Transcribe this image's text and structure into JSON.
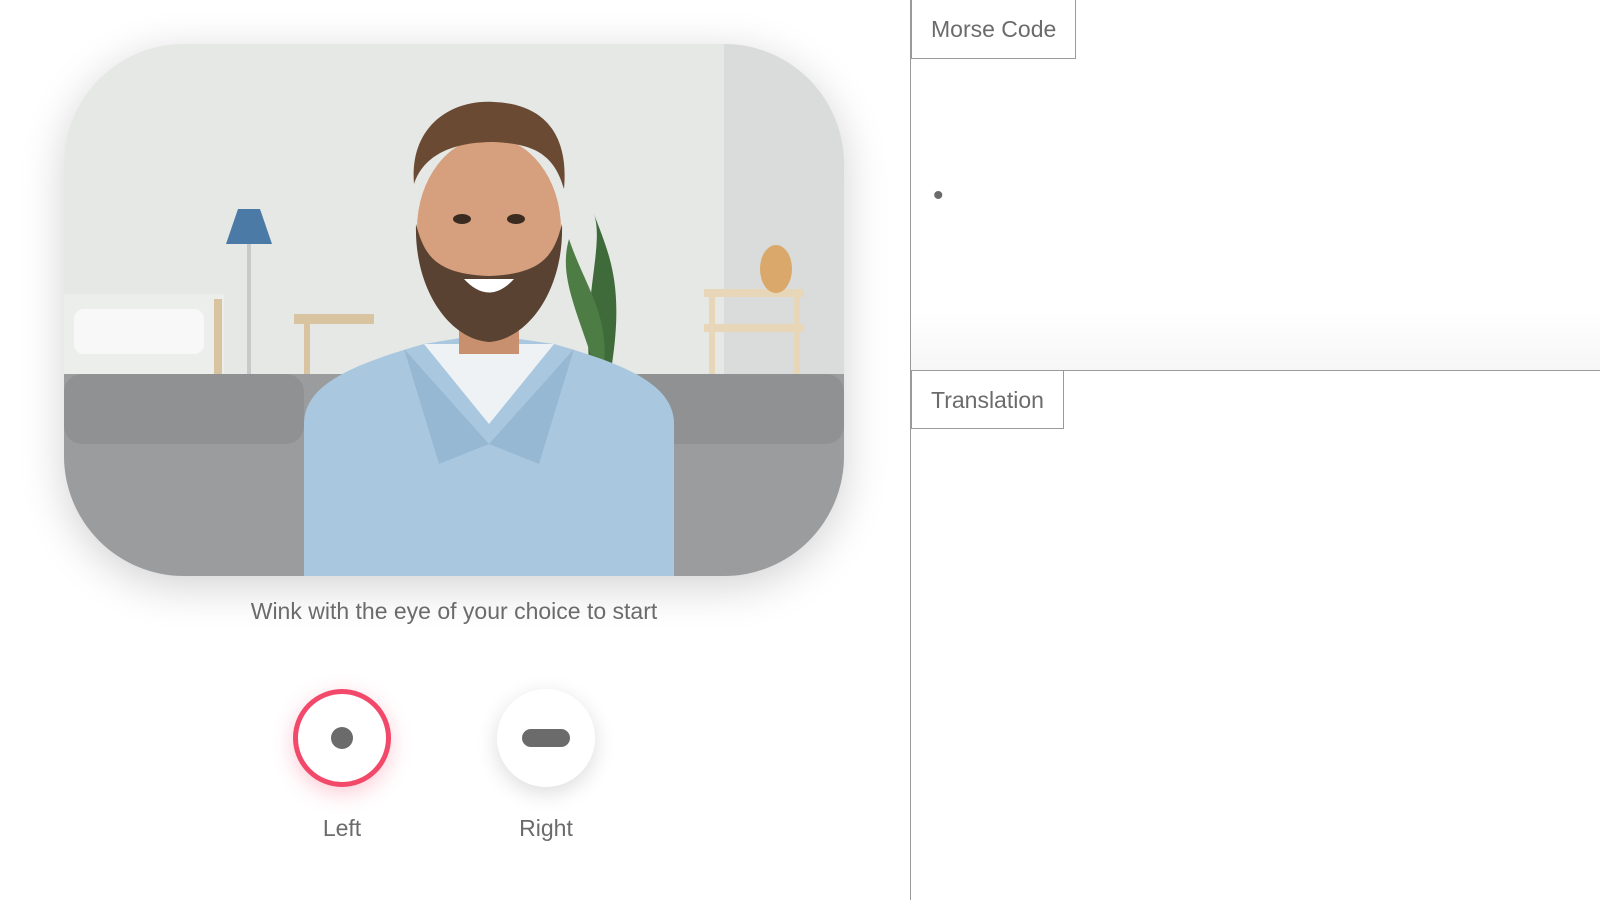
{
  "camera": {
    "instruction": "Wink with the eye of your choice to start"
  },
  "eye_controls": {
    "left": {
      "label": "Left",
      "symbol": "dot",
      "active": true,
      "accent_color": "#f2486a"
    },
    "right": {
      "label": "Right",
      "symbol": "dash",
      "active": false
    }
  },
  "morse_panel": {
    "title": "Morse Code",
    "symbols": "•"
  },
  "translation_panel": {
    "title": "Translation",
    "text": ""
  },
  "colors": {
    "text": "#6b6b6b",
    "border": "#9a9a9a",
    "accent": "#f2486a",
    "background": "#ffffff"
  }
}
